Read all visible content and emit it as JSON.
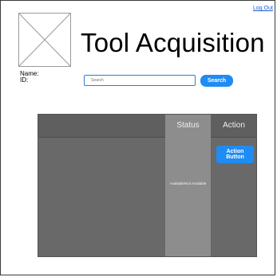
{
  "header": {
    "logout_label": "Log Out",
    "title": "Tool Acquisition",
    "logo_icon": "image-placeholder-icon"
  },
  "user": {
    "name_label": "Name:",
    "id_label": "ID:"
  },
  "search": {
    "placeholder": "Search",
    "button_label": "Search"
  },
  "table": {
    "columns": [
      "",
      "Status",
      "Action"
    ],
    "status_cell": "Available/Not Available",
    "action_button_label": "Action Button"
  },
  "colors": {
    "accent": "#1f8cf3",
    "panel": "#696969",
    "status_column": "#8d8d8d"
  }
}
